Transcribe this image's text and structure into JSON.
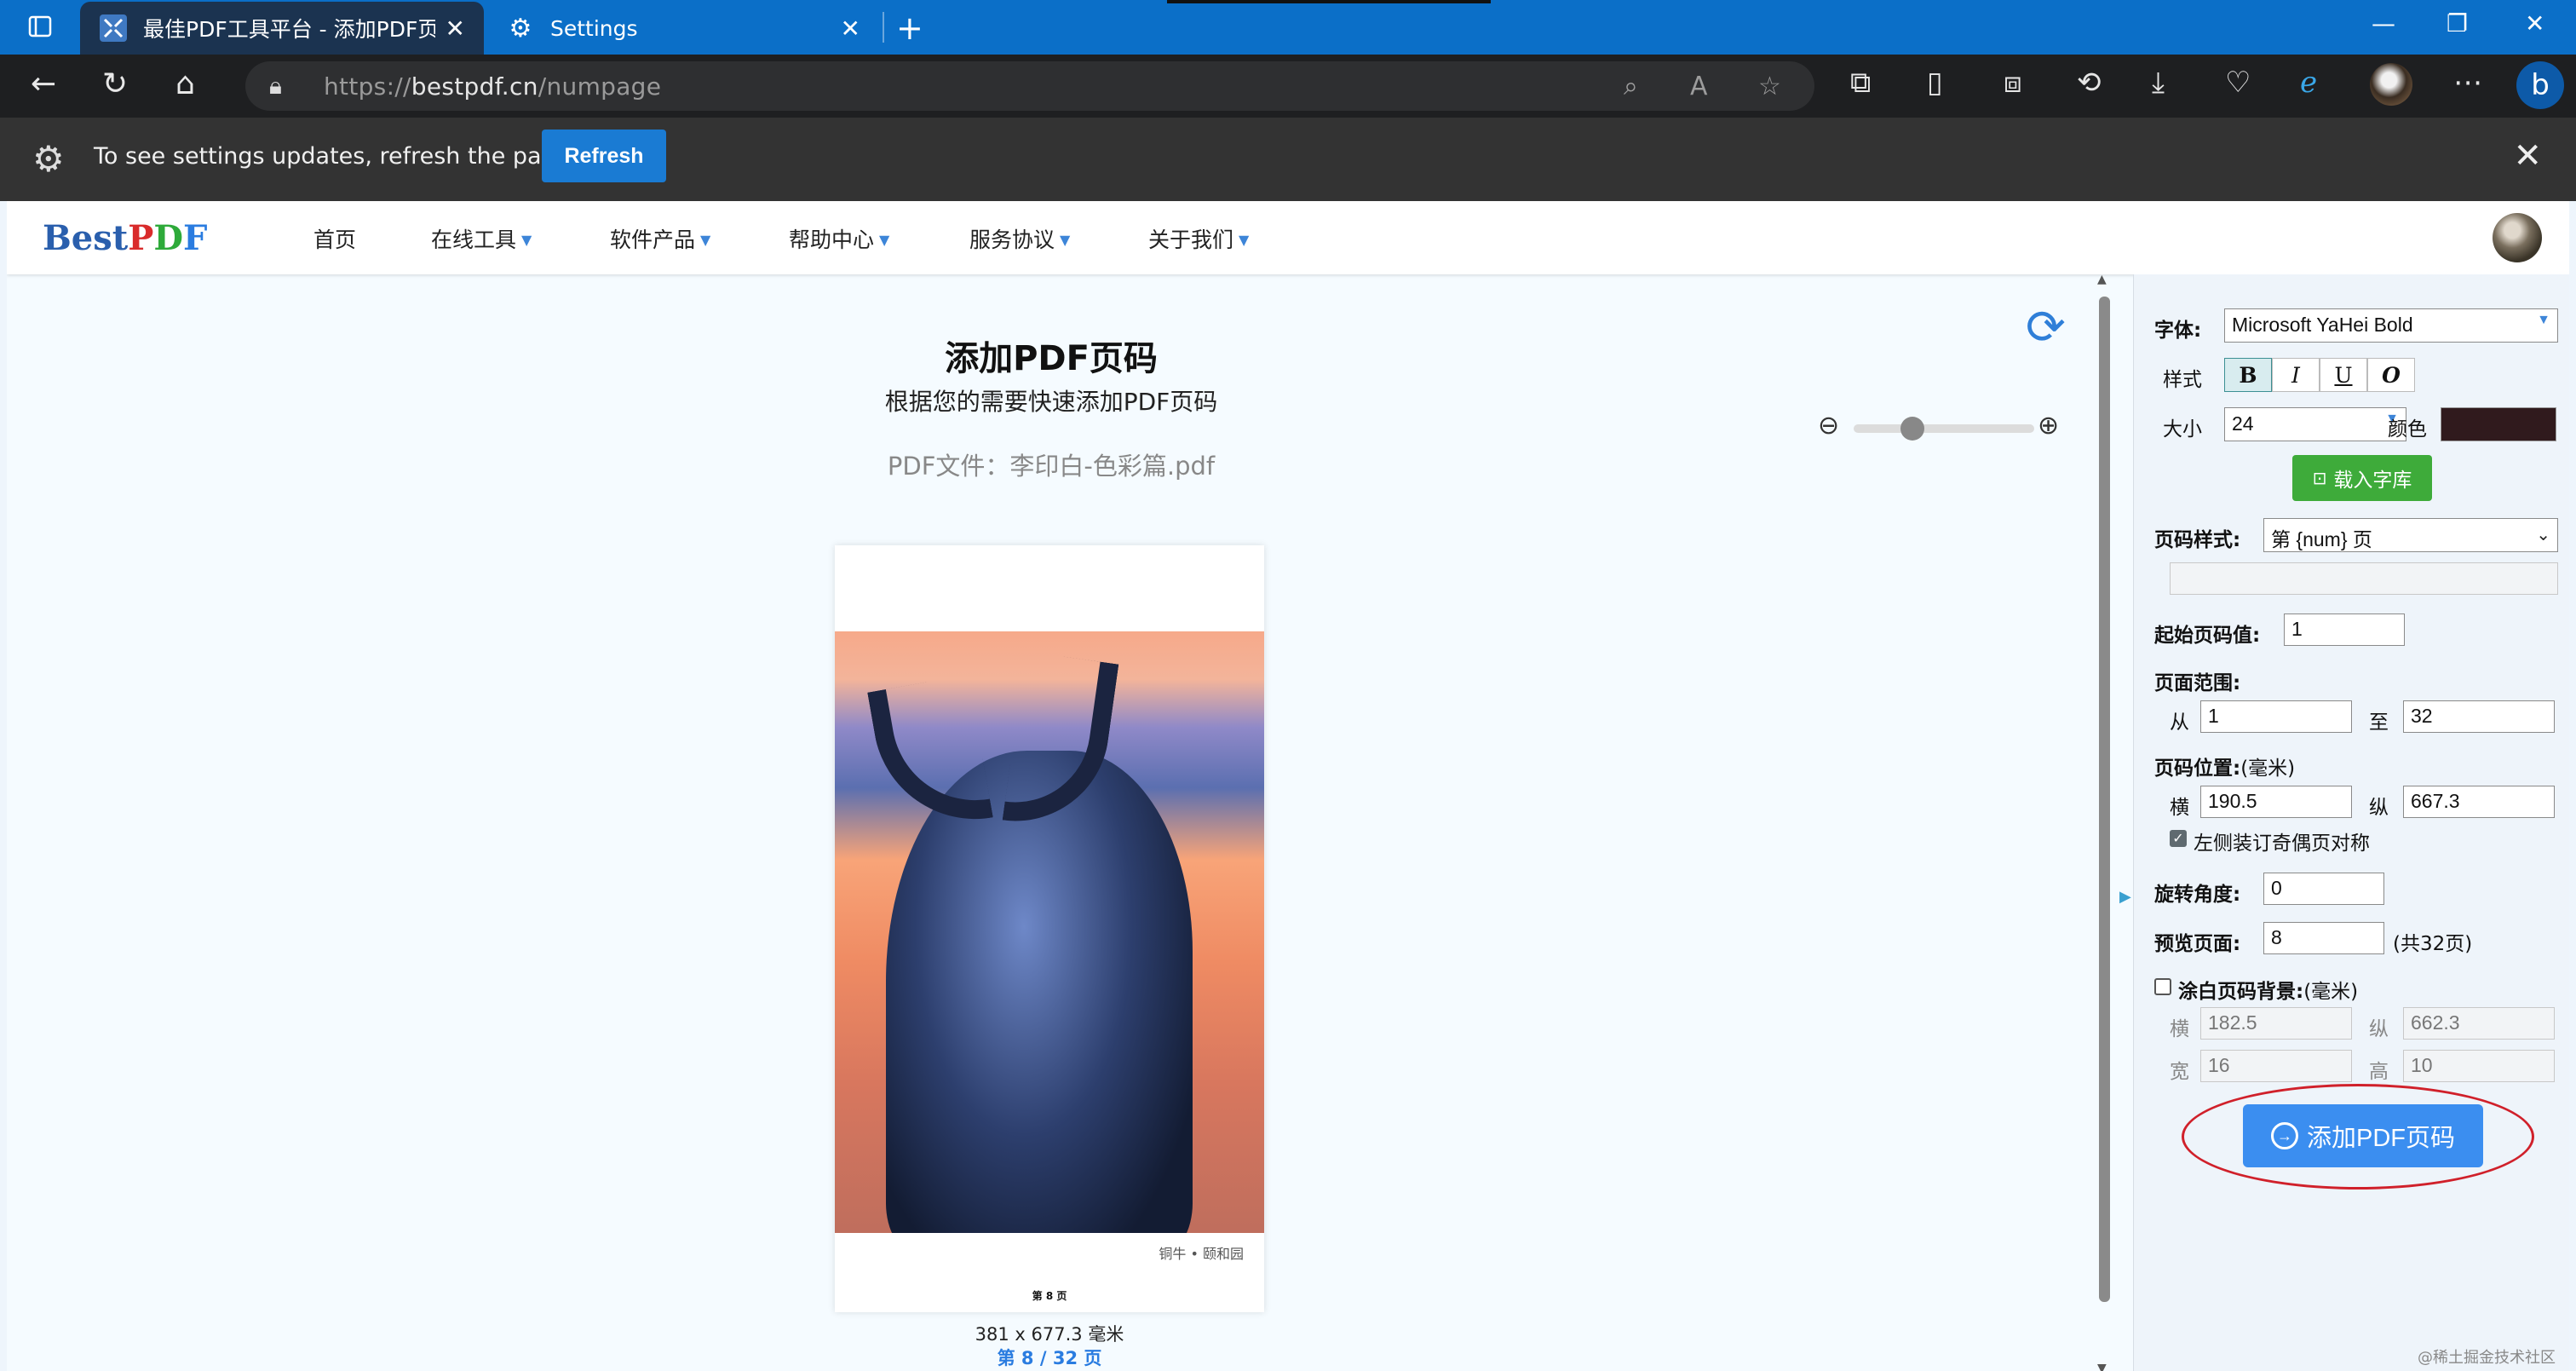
{
  "browser": {
    "tabs": [
      {
        "title": "最佳PDF工具平台 - 添加PDF页码",
        "active": true
      },
      {
        "title": "Settings",
        "active": false
      }
    ],
    "url_prefix": "https://",
    "url_host": "bestpdf.cn",
    "url_path": "/numpage",
    "infobar_message": "To see settings updates, refresh the page",
    "infobar_button": "Refresh"
  },
  "site": {
    "logo_best": "Best",
    "logo_p": "P",
    "logo_d": "D",
    "logo_f": "F",
    "nav": [
      "首页",
      "在线工具",
      "软件产品",
      "帮助中心",
      "服务协议",
      "关于我们"
    ]
  },
  "main": {
    "title": "添加PDF页码",
    "subtitle": "根据您的需要快速添加PDF页码",
    "file_line": "PDF文件：李印白-色彩篇.pdf",
    "zoom_level": 0.3,
    "photo_caption": "铜牛 • 颐和园",
    "page_number_mark": "第 8 页",
    "page_size": "381 x 677.3 毫米",
    "page_indicator": "第 8 / 32 页"
  },
  "panel": {
    "font_label": "字体:",
    "font_value": "Microsoft YaHei Bold",
    "style_label": "样式",
    "style_buttons": [
      "B",
      "I",
      "U",
      "O"
    ],
    "size_label": "大小",
    "size_value": "24",
    "color_label": "颜色",
    "color_value": "#301a1d",
    "load_font_button": "载入字库",
    "number_style_label": "页码样式:",
    "number_style_value": "第 {num} 页",
    "start_value_label": "起始页码值:",
    "start_value": "1",
    "range_label": "页面范围:",
    "range_from_label": "从",
    "range_from": "1",
    "range_to_label": "至",
    "range_to": "32",
    "position_label": "页码位置:",
    "unit_mm": "(毫米)",
    "pos_x_label": "横",
    "pos_x": "190.5",
    "pos_y_label": "纵",
    "pos_y": "667.3",
    "mirror_label": "左侧装订奇偶页对称",
    "mirror_checked": true,
    "rotation_label": "旋转角度:",
    "rotation": "0",
    "preview_label": "预览页面:",
    "preview_page": "8",
    "preview_total": "(共32页)",
    "whiteout_label": "涂白页码背景:",
    "whiteout_checked": false,
    "wo_x_label": "横",
    "wo_x": "182.5",
    "wo_y_label": "纵",
    "wo_y": "662.3",
    "wo_w_label": "宽",
    "wo_w": "16",
    "wo_h_label": "高",
    "wo_h": "10",
    "submit_button": "添加PDF页码"
  },
  "watermark": "@稀土掘金技术社区"
}
